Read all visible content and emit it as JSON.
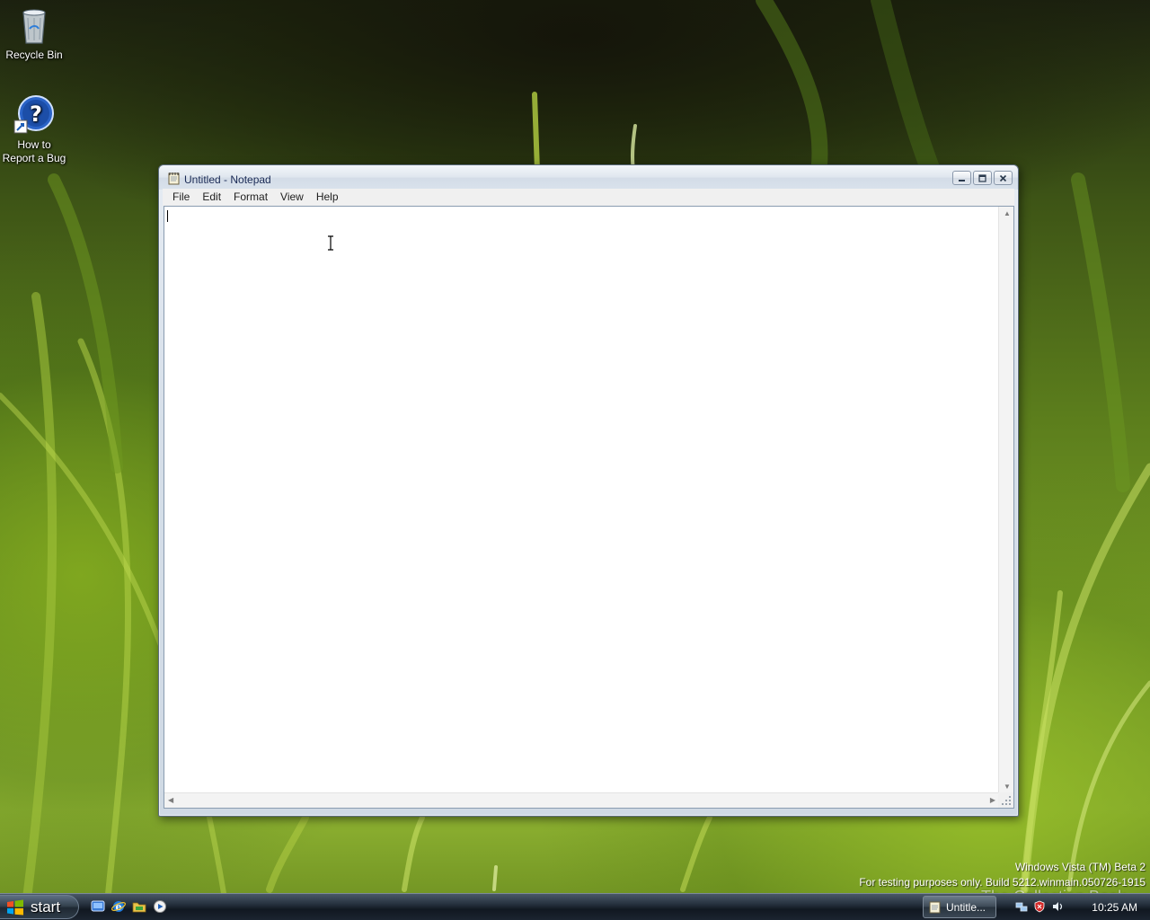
{
  "desktop": {
    "icons": [
      {
        "label": "Recycle Bin",
        "icon": "recycle-bin-icon"
      },
      {
        "label_line1": "How to",
        "label_line2": "Report a Bug",
        "icon": "help-question-icon"
      }
    ],
    "watermark": {
      "line1": "Windows Vista (TM) Beta 2",
      "line2": "For testing purposes only. Build 5212.winmain.050726-1915"
    },
    "overlay_mark": "The Collection Book"
  },
  "window": {
    "title": "Untitled - Notepad",
    "icon": "notepad-icon",
    "menu": [
      "File",
      "Edit",
      "Format",
      "View",
      "Help"
    ],
    "content": "",
    "caption_buttons": {
      "minimize": "minimize-icon",
      "maximize": "maximize-icon",
      "close": "close-icon"
    }
  },
  "taskbar": {
    "start_label": "start",
    "quick_launch": [
      "show-desktop-icon",
      "internet-explorer-icon",
      "windows-explorer-icon",
      "media-player-icon"
    ],
    "task_buttons": [
      {
        "label": "Untitle...",
        "icon": "notepad-icon"
      }
    ],
    "tray_icons": [
      "network-icon",
      "security-shield-icon",
      "volume-icon"
    ],
    "clock": "10:25 AM"
  },
  "colors": {
    "title_text": "#1a2a55",
    "taskbar": "#1b2430",
    "wallpaper_green": "#7aa027"
  }
}
